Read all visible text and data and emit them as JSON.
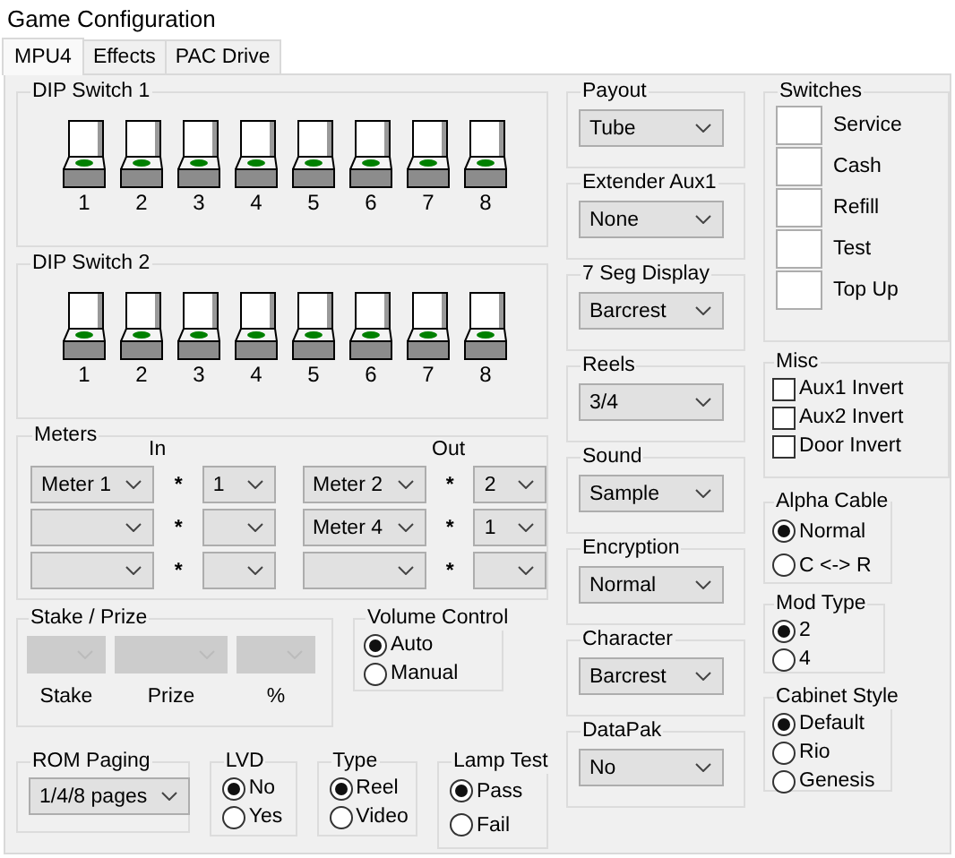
{
  "window": {
    "title": "Game Configuration"
  },
  "tabs": [
    {
      "label": "MPU4",
      "selected": true
    },
    {
      "label": "Effects",
      "selected": false
    },
    {
      "label": "PAC Drive",
      "selected": false
    }
  ],
  "dip_switches": [
    {
      "title": "DIP Switch 1",
      "switches": [
        {
          "label": "1",
          "on": true
        },
        {
          "label": "2",
          "on": true
        },
        {
          "label": "3",
          "on": true
        },
        {
          "label": "4",
          "on": true
        },
        {
          "label": "5",
          "on": true
        },
        {
          "label": "6",
          "on": true
        },
        {
          "label": "7",
          "on": true
        },
        {
          "label": "8",
          "on": true
        }
      ]
    },
    {
      "title": "DIP Switch 2",
      "switches": [
        {
          "label": "1",
          "on": true
        },
        {
          "label": "2",
          "on": true
        },
        {
          "label": "3",
          "on": true
        },
        {
          "label": "4",
          "on": true
        },
        {
          "label": "5",
          "on": true
        },
        {
          "label": "6",
          "on": true
        },
        {
          "label": "7",
          "on": true
        },
        {
          "label": "8",
          "on": true
        }
      ]
    }
  ],
  "meters": {
    "title": "Meters",
    "in_label": "In",
    "out_label": "Out",
    "rows": [
      {
        "in": {
          "meter": "Meter 1",
          "sep": "*",
          "factor": "1"
        },
        "out": {
          "meter": "Meter 2",
          "sep": "*",
          "factor": "2"
        }
      },
      {
        "in": {
          "sep": "*"
        },
        "out": {
          "meter": "Meter 4",
          "sep": "*",
          "factor": "1"
        }
      },
      {
        "in": {
          "sep": "*"
        },
        "out": {
          "sep": "*"
        }
      }
    ]
  },
  "stake_prize": {
    "title": "Stake / Prize",
    "fields": [
      {
        "label": "Stake",
        "disabled": true
      },
      {
        "label": "Prize",
        "disabled": true
      },
      {
        "label": "%",
        "disabled": true
      }
    ]
  },
  "volume_control": {
    "title": "Volume Control",
    "options": [
      {
        "label": "Auto",
        "selected": true
      },
      {
        "label": "Manual",
        "selected": false
      }
    ]
  },
  "rom_paging": {
    "title": "ROM Paging",
    "value": "1/4/8 pages"
  },
  "lvd": {
    "title": "LVD",
    "options": [
      {
        "label": "No",
        "selected": true
      },
      {
        "label": "Yes",
        "selected": false
      }
    ]
  },
  "type": {
    "title": "Type",
    "options": [
      {
        "label": "Reel",
        "selected": true
      },
      {
        "label": "Video",
        "selected": false
      }
    ]
  },
  "lamp_test": {
    "title": "Lamp Test",
    "options": [
      {
        "label": "Pass",
        "selected": true
      },
      {
        "label": "Fail",
        "selected": false
      }
    ]
  },
  "dropdown_groups": [
    {
      "title": "Payout",
      "value": "Tube"
    },
    {
      "title": "Extender Aux1",
      "value": "None"
    },
    {
      "title": "7 Seg Display",
      "value": "Barcrest"
    },
    {
      "title": "Reels",
      "value": "3/4"
    },
    {
      "title": "Sound",
      "value": "Sample"
    },
    {
      "title": "Encryption",
      "value": "Normal"
    },
    {
      "title": "Character",
      "value": "Barcrest"
    },
    {
      "title": "DataPak",
      "value": "No"
    }
  ],
  "switches": {
    "title": "Switches",
    "items": [
      {
        "label": "Service",
        "on": false
      },
      {
        "label": "Cash",
        "on": false
      },
      {
        "label": "Refill",
        "on": false
      },
      {
        "label": "Test",
        "on": false
      },
      {
        "label": "Top Up",
        "on": false
      }
    ]
  },
  "misc": {
    "title": "Misc",
    "items": [
      {
        "label": "Aux1 Invert",
        "checked": false
      },
      {
        "label": "Aux2 Invert",
        "checked": false
      },
      {
        "label": "Door Invert",
        "checked": false
      }
    ]
  },
  "alpha_cable": {
    "title": "Alpha Cable",
    "options": [
      {
        "label": "Normal",
        "selected": true
      },
      {
        "label": "C <-> R",
        "selected": false
      }
    ]
  },
  "mod_type": {
    "title": "Mod Type",
    "options": [
      {
        "label": "2",
        "selected": true
      },
      {
        "label": "4",
        "selected": false
      }
    ]
  },
  "cabinet_style": {
    "title": "Cabinet Style",
    "options": [
      {
        "label": "Default",
        "selected": true
      },
      {
        "label": "Rio",
        "selected": false
      },
      {
        "label": "Genesis",
        "selected": false
      }
    ]
  }
}
